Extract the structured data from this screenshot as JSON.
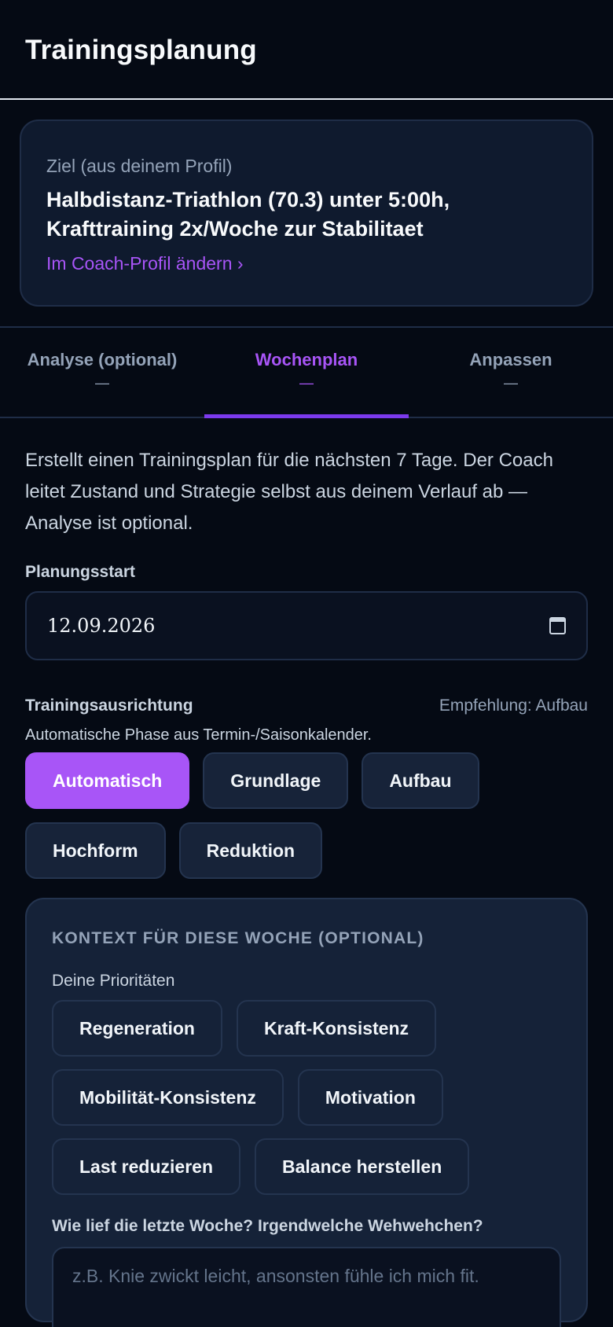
{
  "header": {
    "title": "Trainingsplanung"
  },
  "goal": {
    "label": "Ziel (aus deinem Profil)",
    "text": "Halbdistanz-Triathlon (70.3) unter 5:00h, Krafttraining 2x/Woche zur Stabilitaet",
    "link": "Im Coach-Profil ändern ›"
  },
  "tabs": [
    {
      "label": "Analyse (optional)",
      "sub": "—",
      "active": false
    },
    {
      "label": "Wochenplan",
      "sub": "—",
      "active": true
    },
    {
      "label": "Anpassen",
      "sub": "—",
      "active": false
    }
  ],
  "description": "Erstellt einen Trainingsplan für die nächsten 7 Tage. Der Coach leitet Zustand und Strategie selbst aus deinem Verlauf ab — Analyse ist optional.",
  "planning_start": {
    "label": "Planungsstart",
    "value": "12.09.2026",
    "icon": "calendar-icon"
  },
  "orientation": {
    "label": "Trainingsausrichtung",
    "recommendation": "Empfehlung: Aufbau",
    "hint": "Automatische Phase aus Termin-/Saisonkalender.",
    "options": [
      "Automatisch",
      "Grundlage",
      "Aufbau",
      "Hochform",
      "Reduktion"
    ],
    "selected": "Automatisch"
  },
  "context": {
    "title": "KONTEXT FÜR DIESE WOCHE (OPTIONAL)",
    "priorities_label": "Deine Prioritäten",
    "priorities": [
      "Regeneration",
      "Kraft-Konsistenz",
      "Mobilität-Konsistenz",
      "Motivation",
      "Last reduzieren",
      "Balance herstellen"
    ],
    "week_label": "Wie lief die letzte Woche? Irgendwelche Wehwehchen?",
    "week_placeholder": "z.B. Knie zwickt leicht, ansonsten fühle ich mich fit."
  },
  "colors": {
    "accent": "#a855f7",
    "background": "#050a14",
    "card": "#0f1a2e"
  }
}
